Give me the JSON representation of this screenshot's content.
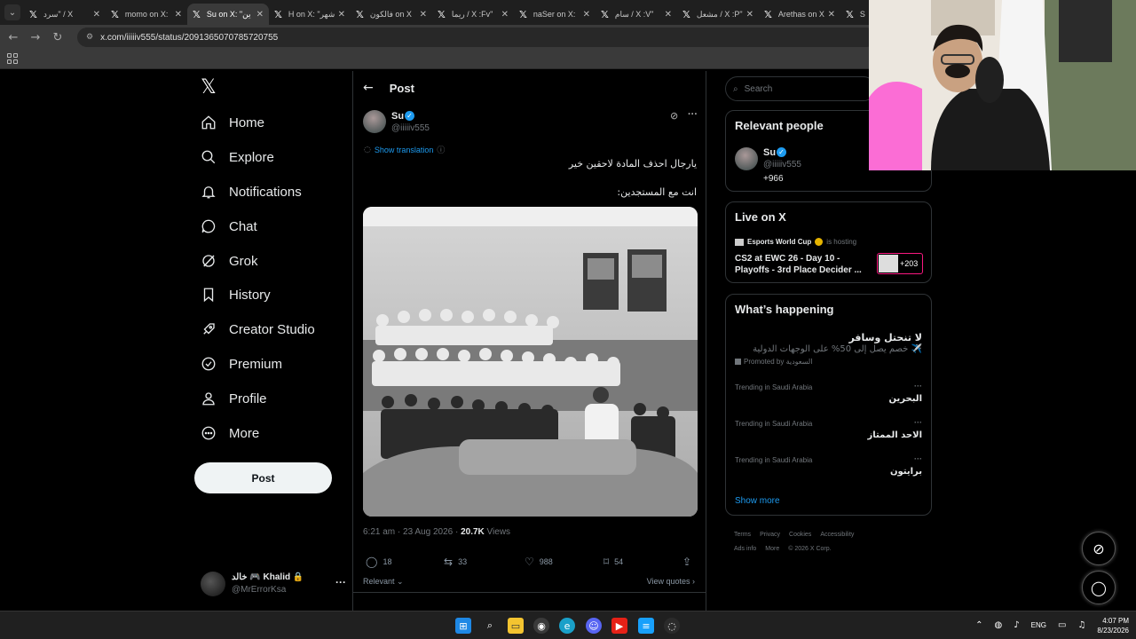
{
  "browser": {
    "tabs": [
      {
        "title": "سرد\" / X"
      },
      {
        "title": "momo on X:"
      },
      {
        "title": "Su on X: \"ين"
      },
      {
        "title": "H on X: \"شهر"
      },
      {
        "title": "فالكون on X"
      },
      {
        "title": "ريما / X :Fv\""
      },
      {
        "title": "naSer on X:"
      },
      {
        "title": "سام / X :V\""
      },
      {
        "title": "مشعل / X :P\""
      },
      {
        "title": "Arethas on X"
      },
      {
        "title": "S"
      }
    ],
    "url": "x.com/iiiiiv555/status/2091365070785720755"
  },
  "nav": {
    "items": [
      {
        "label": "Home",
        "icon": "home-icon"
      },
      {
        "label": "Explore",
        "icon": "search-icon"
      },
      {
        "label": "Notifications",
        "icon": "bell-icon"
      },
      {
        "label": "Chat",
        "icon": "chat-icon"
      },
      {
        "label": "Grok",
        "icon": "grok-icon"
      },
      {
        "label": "History",
        "icon": "bookmark-icon"
      },
      {
        "label": "Creator Studio",
        "icon": "rocket-icon"
      },
      {
        "label": "Premium",
        "icon": "premium-icon"
      },
      {
        "label": "Profile",
        "icon": "profile-icon"
      },
      {
        "label": "More",
        "icon": "more-icon"
      }
    ],
    "post_button": "Post",
    "account": {
      "name": "خالد 🎮 Khalid 🔒",
      "handle": "@MrErrorKsa"
    }
  },
  "post": {
    "heading": "Post",
    "author_name": "Su",
    "author_handle": "@iiiiiv555",
    "show_translation": "Show translation",
    "text_line1": "يارجال احذف المادة لاحقين خير",
    "text_line2": "انت مع المستجدين:",
    "timestamp": "6:21 am · 23 Aug 2026 · ",
    "views_count": "20.7K",
    "views_label": " Views",
    "replies": "18",
    "reposts": "33",
    "likes": "988",
    "bookmarks": "54",
    "relevant": "Relevant",
    "view_quotes": "View quotes"
  },
  "sidebar": {
    "search_placeholder": "Search",
    "relevant_people": {
      "title": "Relevant people",
      "name": "Su",
      "handle": "@iiiiiv555",
      "bio": "+966"
    },
    "live": {
      "title": "Live on X",
      "host": "Esports World Cup",
      "host_suffix": "is hosting",
      "event": "CS2 at EWC 26 - Day 10 - Playoffs - 3rd Place Decider ...",
      "listeners": "+203"
    },
    "happening": {
      "title": "What’s happening",
      "promo_title": "لا تنحتل وسافر",
      "promo_desc": "✈️ خصم يصل إلى 50% على الوجهات الدولية",
      "promo_by": "Promoted by السعودية",
      "trends": [
        {
          "context": "Trending in Saudi Arabia",
          "name": "البحرين"
        },
        {
          "context": "Trending in Saudi Arabia",
          "name": "الاحد الممتاز"
        },
        {
          "context": "Trending in Saudi Arabia",
          "name": "برايتون"
        }
      ],
      "show_more": "Show more"
    },
    "footer": [
      "Terms",
      "Privacy",
      "Cookies",
      "Accessibility",
      "Ads info",
      "More",
      "© 2026 X Corp."
    ]
  },
  "taskbar": {
    "lang": "ENG",
    "time": "4:07 PM",
    "date": "8/23/2026"
  }
}
